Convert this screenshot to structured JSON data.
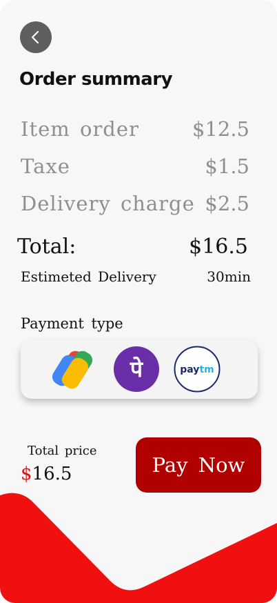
{
  "header": {
    "title": "Order summary"
  },
  "summary": {
    "items": [
      {
        "label": "Item order",
        "value": "$12.5"
      },
      {
        "label": "Taxe",
        "value": "$1.5"
      },
      {
        "label": "Delivery charge",
        "value": "$2.5"
      }
    ],
    "total_label": "Total:",
    "total_value": "$16.5",
    "estimate_label": "Estimeted Delivery",
    "estimate_value": "30min"
  },
  "payment": {
    "label": "Payment type",
    "methods": [
      {
        "name": "Google Pay",
        "icon": "google-pay-icon"
      },
      {
        "name": "PhonePe",
        "icon": "phonepe-icon",
        "glyph": "पे"
      },
      {
        "name": "Paytm",
        "icon": "paytm-icon",
        "text_pay": "pay",
        "text_tm": "tm"
      }
    ]
  },
  "footer": {
    "total_price_label": "Total price",
    "currency": "$",
    "total_price_value": "16.5",
    "pay_button_label": "Pay Now"
  },
  "colors": {
    "accent_red": "#e01010",
    "button_red": "#b00000",
    "back_button": "#5f5f5f",
    "muted_text": "#8f8f8f",
    "phonepe_purple": "#6a2fa8",
    "paytm_navy": "#1c2a6c",
    "paytm_blue": "#20b4e8"
  }
}
